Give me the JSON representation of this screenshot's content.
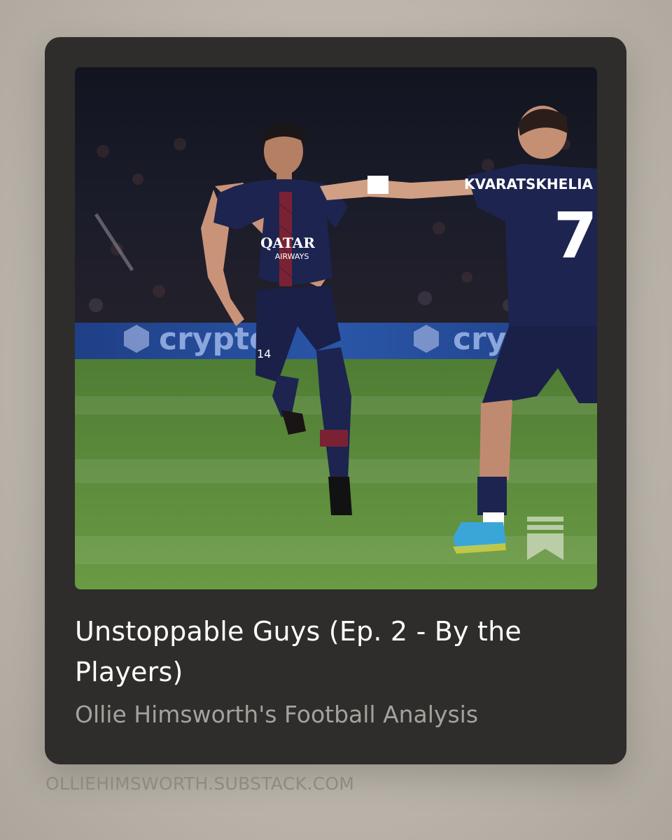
{
  "card": {
    "title": "Unstoppable Guys (Ep. 2 - By the Players)",
    "publication": "Ollie Himsworth's Football Analysis",
    "image": {
      "board_text": "crypto",
      "sponsor_top": "QATAR",
      "sponsor_bottom": "AIRWAYS",
      "shirt_name": "KVARATSKHELIA",
      "shirt_number": "7",
      "short_number": "14"
    }
  },
  "footer": {
    "url": "OLLIEHIMSWORTH.SUBSTACK.COM"
  },
  "colors": {
    "background": "#bdb7ad",
    "card": "#2e2d2b",
    "title": "#ffffff",
    "subtitle": "#a5a29d",
    "footer_text": "#8e8a83",
    "kit_navy": "#1d2450",
    "pitch_green": "#5e8e3c"
  },
  "icons": {
    "brand": "substack-bookmark-icon"
  }
}
